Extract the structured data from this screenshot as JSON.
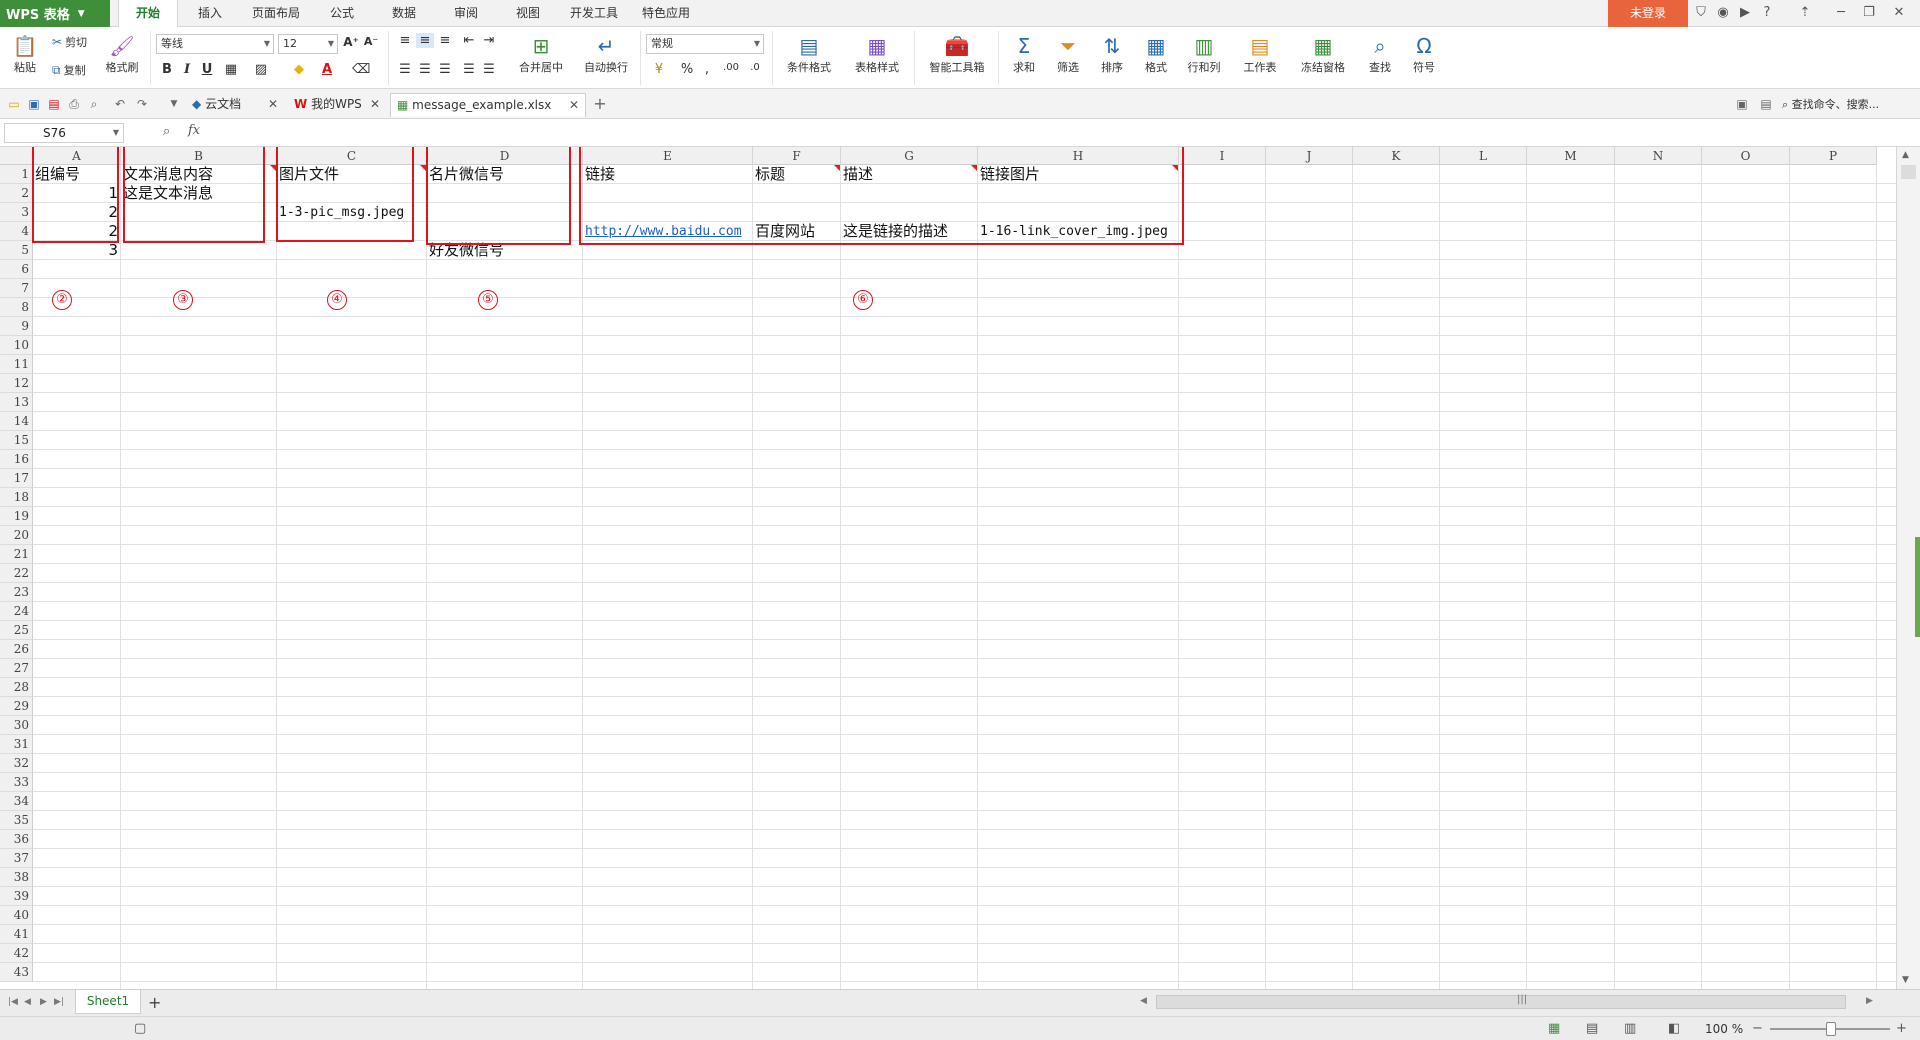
{
  "app": {
    "title": "WPS 表格"
  },
  "ribbon_tabs": [
    {
      "label": "开始",
      "active": true
    },
    {
      "label": "插入"
    },
    {
      "label": "页面布局"
    },
    {
      "label": "公式"
    },
    {
      "label": "数据"
    },
    {
      "label": "审阅"
    },
    {
      "label": "视图"
    },
    {
      "label": "开发工具"
    },
    {
      "label": "特色应用"
    }
  ],
  "login_label": "未登录",
  "ribbon": {
    "paste": "粘贴",
    "cut": "剪切",
    "copy": "复制",
    "format_painter": "格式刷",
    "font_name": "等线",
    "font_size": "12",
    "merge_center": "合并居中",
    "wrap_text": "自动换行",
    "number_format": "常规",
    "conditional_format": "条件格式",
    "table_style": "表格样式",
    "smart_toolbox": "智能工具箱",
    "sum": "求和",
    "filter": "筛选",
    "sort": "排序",
    "format": "格式",
    "row_col": "行和列",
    "worksheet": "工作表",
    "freeze": "冻结窗格",
    "find": "查找",
    "symbol": "符号"
  },
  "doc_tabs": [
    {
      "label": "云文档"
    },
    {
      "label": "我的WPS"
    },
    {
      "label": "message_example.xlsx",
      "active": true
    }
  ],
  "search_command": "查找命令、搜索...",
  "formula_bar": {
    "name_box": "S76",
    "fx": "fx"
  },
  "columns": [
    "A",
    "B",
    "C",
    "D",
    "E",
    "F",
    "G",
    "H",
    "I",
    "J",
    "K",
    "L",
    "M",
    "N",
    "O",
    "P"
  ],
  "rows": [
    "1",
    "2",
    "3",
    "4",
    "5",
    "6",
    "7",
    "8",
    "9",
    "10",
    "11",
    "12",
    "13",
    "14",
    "15",
    "16",
    "17",
    "18",
    "19",
    "20",
    "21",
    "22",
    "23",
    "24",
    "25",
    "26",
    "27",
    "28",
    "29",
    "30",
    "31",
    "32",
    "33",
    "34",
    "35",
    "36",
    "37",
    "38",
    "39",
    "40",
    "41",
    "42",
    "43"
  ],
  "cells": {
    "A1": "组编号",
    "A2": "1",
    "A3": "2",
    "A4": "2",
    "A5": "3",
    "B1": "文本消息内容",
    "B2": "这是文本消息",
    "C1": "图片文件",
    "C3": "1-3-pic_msg.jpeg",
    "D1": "名片微信号",
    "D5": "好友微信号",
    "E1": "链接",
    "E4": "http://www.baidu.com",
    "F1": "标题",
    "F4": "百度网站",
    "G1": "描述",
    "G4": "这是链接的描述",
    "H1": "链接图片",
    "H4": "1-16-link_cover_img.jpeg"
  },
  "annotations": [
    "②",
    "③",
    "④",
    "⑤",
    "⑥"
  ],
  "annotation_color": "#e0131b",
  "sheet_tab": "Sheet1",
  "status": {
    "zoom": "100 %"
  },
  "colors": {
    "brand_green": "#3f8f3a",
    "login_orange": "#e8643c",
    "link_blue": "#1a5fd0"
  }
}
